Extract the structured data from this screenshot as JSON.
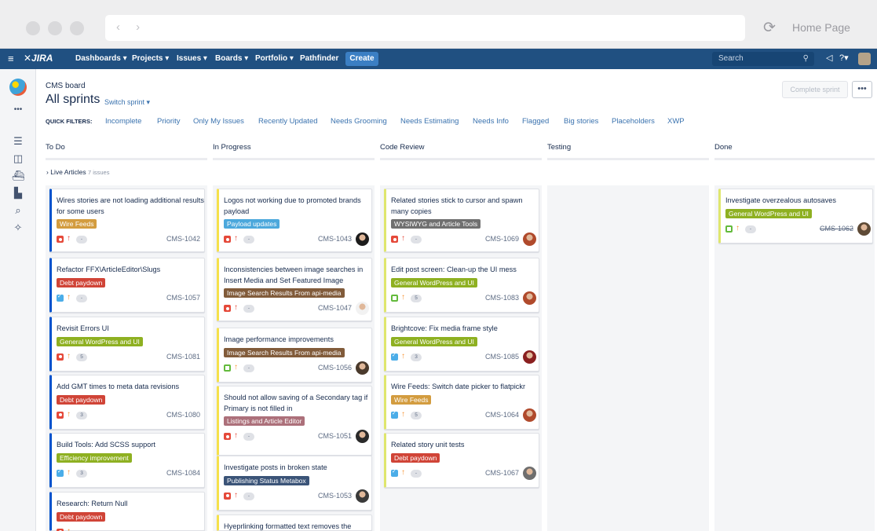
{
  "browser": {
    "nav_arrows": "‹ ›",
    "reload_icon": "⟳",
    "home_label": "Home Page"
  },
  "nav": {
    "menu_icon": "≡",
    "logo": "✕JIRA",
    "items": [
      "Dashboards ▾",
      "Projects ▾",
      "Issues ▾",
      "Boards ▾",
      "Portfolio ▾",
      "Pathfinder"
    ],
    "create": "Create",
    "search_placeholder": "Search",
    "search_icon": "⚲",
    "notify_icon": "◁",
    "help_icon": "?▾"
  },
  "board": {
    "breadcrumb": "CMS board",
    "title": "All sprints",
    "switch_sprint": "Switch sprint ▾",
    "complete_sprint": "Complete sprint",
    "more": "•••",
    "quick_filters_label": "QUICK FILTERS:",
    "filters": [
      "Incomplete",
      "Priority",
      "Only My Issues",
      "Recently Updated",
      "Needs Grooming",
      "Needs Estimating",
      "Needs Info",
      "Flagged",
      "Big stories",
      "Placeholders",
      "XWP"
    ],
    "columns": [
      "To Do",
      "In Progress",
      "Code Review",
      "Testing",
      "Done"
    ],
    "swimlane": {
      "name": "Live Articles",
      "count": "7 issues"
    }
  },
  "colors": {
    "nav": "#205081",
    "bug": "#e5493a",
    "story": "#63ba3c",
    "task": "#4bade8",
    "priority_high": "#e5493a",
    "priority_med": "#f79232"
  },
  "cards": [
    {
      "col": 0,
      "summary": "Wires stories are not loading additional results for some users",
      "epic": "Wire Feeds",
      "epic_color": "#d39c3f",
      "type": "bug",
      "est": "-",
      "key": "CMS-1042"
    },
    {
      "col": 0,
      "summary": "Refactor FFX\\ArticleEditor\\Slugs",
      "epic": "Debt paydown",
      "epic_color": "#d04437",
      "type": "task",
      "est": "-",
      "key": "CMS-1057"
    },
    {
      "col": 0,
      "summary": "Revisit Errors UI",
      "epic": "General WordPress and UI",
      "epic_color": "#8eb021",
      "type": "bug",
      "est": "5",
      "key": "CMS-1081"
    },
    {
      "col": 0,
      "summary": "Add GMT times to meta data revisions",
      "epic": "Debt paydown",
      "epic_color": "#d04437",
      "type": "bug",
      "est": "3",
      "key": "CMS-1080"
    },
    {
      "col": 0,
      "summary": "Build Tools: Add SCSS support",
      "epic": "Efficiency improvement",
      "epic_color": "#8eb021",
      "type": "task",
      "est": "3",
      "key": "CMS-1084"
    },
    {
      "col": 0,
      "summary": "Research: Return Null",
      "epic": "Debt paydown",
      "epic_color": "#d04437",
      "type": "bug",
      "est": "",
      "key": ""
    },
    {
      "col": 1,
      "summary": "Logos not working due to promoted brands payload",
      "epic": "Payload updates",
      "epic_color": "#4ca8dc",
      "type": "bug",
      "est": "-",
      "key": "CMS-1043"
    },
    {
      "col": 1,
      "summary": "Inconsistencies between image searches in Insert Media and Set Featured Image",
      "epic": "Image Search Results From api-media",
      "epic_color": "#815b3a",
      "type": "bug",
      "est": "-",
      "key": "CMS-1047"
    },
    {
      "col": 1,
      "summary": "Image performance improvements",
      "epic": "Image Search Results From api-media",
      "epic_color": "#815b3a",
      "type": "story",
      "est": "-",
      "key": "CMS-1056"
    },
    {
      "col": 1,
      "summary": "Should not allow saving of a Secondary tag if Primary is not filled in",
      "epic": "Listings and Article Editor",
      "epic_color": "#ac707a",
      "type": "bug",
      "est": "-",
      "key": "CMS-1051"
    },
    {
      "col": 1,
      "summary": "Investigate posts in broken state",
      "epic": "Publishing Status Metabox",
      "epic_color": "#3b5478",
      "type": "bug",
      "est": "-",
      "key": "CMS-1053"
    },
    {
      "col": 1,
      "summary": "Hyeprlinking formatted text removes the",
      "epic": "",
      "epic_color": "",
      "type": "",
      "est": "",
      "key": ""
    },
    {
      "col": 2,
      "summary": "Related stories stick to cursor and spawn many copies",
      "epic": "WYSIWYG and Article Tools",
      "epic_color": "#707070",
      "type": "bug",
      "est": "-",
      "key": "CMS-1069"
    },
    {
      "col": 2,
      "summary": "Edit post screen: Clean-up the UI mess",
      "epic": "General WordPress and UI",
      "epic_color": "#8eb021",
      "type": "story",
      "est": "5",
      "key": "CMS-1083"
    },
    {
      "col": 2,
      "summary": "Brightcove: Fix media frame style",
      "epic": "General WordPress and UI",
      "epic_color": "#8eb021",
      "type": "task",
      "est": "3",
      "key": "CMS-1085"
    },
    {
      "col": 2,
      "summary": "Wire Feeds: Switch date picker to flatpickr",
      "epic": "Wire Feeds",
      "epic_color": "#d39c3f",
      "type": "task",
      "est": "5",
      "key": "CMS-1064"
    },
    {
      "col": 2,
      "summary": "Related story unit tests",
      "epic": "Debt paydown",
      "epic_color": "#d04437",
      "type": "task",
      "est": "-",
      "key": "CMS-1067"
    },
    {
      "col": 4,
      "summary": "Investigate overzealous autosaves",
      "epic": "General WordPress and UI",
      "epic_color": "#8eb021",
      "type": "story",
      "est": "-",
      "key": "CMS-1062"
    }
  ]
}
